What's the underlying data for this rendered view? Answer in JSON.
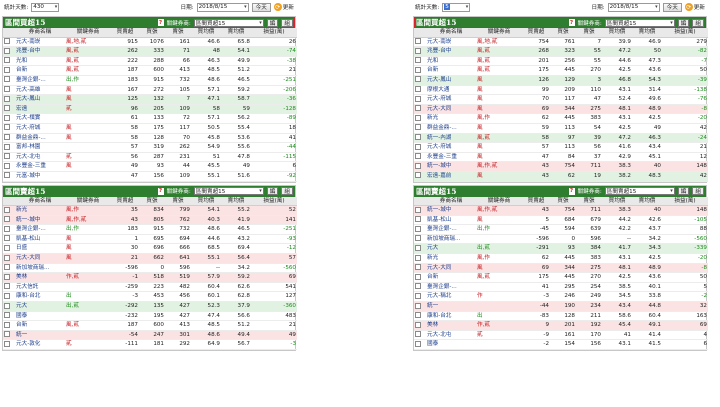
{
  "header_labels": {
    "days_label": "統計天數:",
    "date_label": "日期:",
    "today_button": "今天",
    "refresh_button": "更新",
    "key_broker_label": "關鍵券商:",
    "key_broker_select": "區間買超15",
    "key_broker_select_sell": "區間賣超15",
    "btn_edit": "編",
    "btn_group": "組",
    "help_icon_text": "?"
  },
  "screens": [
    {
      "days_value": "430",
      "date_value": "2018/8/15",
      "buy_title": "區間買超15",
      "sell_title": "區間賣超15",
      "buy_columns": [
        "",
        "券商名稱",
        "關鍵券商",
        "買賣超",
        "買張",
        "賣張",
        "買均價",
        "賣均價",
        "損益(萬)"
      ],
      "sell_columns": [
        "",
        "券商名稱",
        "關鍵券商",
        "買賣超",
        "買張",
        "賣張",
        "買均價",
        "賣均價",
        "損益(萬)"
      ],
      "buy_rows": [
        {
          "name": "元大-南崁",
          "tag": "風,地,貳",
          "net": "915",
          "buy": "1076",
          "sell": "161",
          "bavg": "46.6",
          "savg": "65.8",
          "pnl": "26",
          "row": ""
        },
        {
          "name": "兆豐-台中",
          "tag": "風,貳",
          "net": "262",
          "buy": "333",
          "sell": "71",
          "bavg": "48",
          "savg": "54.1",
          "pnl": "-74",
          "row": "green"
        },
        {
          "name": "光和",
          "tag": "風,貳",
          "net": "222",
          "buy": "288",
          "sell": "66",
          "bavg": "46.3",
          "savg": "49.9",
          "pnl": "-38",
          "row": ""
        },
        {
          "name": "台新",
          "tag": "風,貳",
          "net": "187",
          "buy": "600",
          "sell": "413",
          "bavg": "48.5",
          "savg": "51.2",
          "pnl": "21",
          "row": ""
        },
        {
          "name": "臺灣企銀-...",
          "tag": "出,作",
          "net": "183",
          "buy": "915",
          "sell": "732",
          "bavg": "48.6",
          "savg": "46.5",
          "pnl": "-251",
          "row": ""
        },
        {
          "name": "元大-高雄",
          "tag": "風",
          "net": "167",
          "buy": "272",
          "sell": "105",
          "bavg": "57.1",
          "savg": "59.2",
          "pnl": "-206",
          "row": ""
        },
        {
          "name": "元大-鳳山",
          "tag": "風",
          "net": "125",
          "buy": "132",
          "sell": "7",
          "bavg": "47.1",
          "savg": "58.7",
          "pnl": "-36",
          "row": "green"
        },
        {
          "name": "宏遠",
          "tag": "貳",
          "net": "96",
          "buy": "205",
          "sell": "109",
          "bavg": "58",
          "savg": "59",
          "pnl": "-128",
          "row": "green"
        },
        {
          "name": "元大-樸實",
          "tag": "",
          "net": "61",
          "buy": "133",
          "sell": "72",
          "bavg": "57.1",
          "savg": "56.2",
          "pnl": "-89",
          "row": ""
        },
        {
          "name": "元大-府城",
          "tag": "風",
          "net": "58",
          "buy": "175",
          "sell": "117",
          "bavg": "50.5",
          "savg": "55.4",
          "pnl": "18",
          "row": ""
        },
        {
          "name": "群益金鼎-...",
          "tag": "風",
          "net": "58",
          "buy": "128",
          "sell": "70",
          "bavg": "45.8",
          "savg": "53.6",
          "pnl": "41",
          "row": ""
        },
        {
          "name": "富邦-林園",
          "tag": "",
          "net": "57",
          "buy": "319",
          "sell": "262",
          "bavg": "54.9",
          "savg": "55.6",
          "pnl": "-44",
          "row": ""
        },
        {
          "name": "元大-北屯",
          "tag": "貳",
          "net": "56",
          "buy": "287",
          "sell": "231",
          "bavg": "51",
          "savg": "47.8",
          "pnl": "-115",
          "row": ""
        },
        {
          "name": "永豐金-三重",
          "tag": "風",
          "net": "49",
          "buy": "93",
          "sell": "44",
          "bavg": "45.5",
          "savg": "49",
          "pnl": "6",
          "row": ""
        },
        {
          "name": "元富-城中",
          "tag": "",
          "net": "47",
          "buy": "156",
          "sell": "109",
          "bavg": "55.1",
          "savg": "51.6",
          "pnl": "-92",
          "row": ""
        }
      ],
      "sell_rows": [
        {
          "name": "新光",
          "tag": "風,作",
          "net": "35",
          "buy": "834",
          "sell": "799",
          "bavg": "54.1",
          "savg": "55.2",
          "pnl": "52",
          "row": "pink"
        },
        {
          "name": "統一-城中",
          "tag": "風,作,貳",
          "net": "43",
          "buy": "805",
          "sell": "762",
          "bavg": "40.3",
          "savg": "41.9",
          "pnl": "141",
          "row": "pink"
        },
        {
          "name": "臺灣企銀-...",
          "tag": "出,作",
          "net": "183",
          "buy": "915",
          "sell": "732",
          "bavg": "48.6",
          "savg": "46.5",
          "pnl": "-251",
          "row": ""
        },
        {
          "name": "凱基-松山",
          "tag": "風",
          "net": "1",
          "buy": "695",
          "sell": "694",
          "bavg": "44.6",
          "savg": "43.2",
          "pnl": "-93",
          "row": ""
        },
        {
          "name": "日盛",
          "tag": "風",
          "net": "30",
          "buy": "696",
          "sell": "666",
          "bavg": "68.5",
          "savg": "69.4",
          "pnl": "-12",
          "row": ""
        },
        {
          "name": "元大-大同",
          "tag": "風",
          "net": "21",
          "buy": "662",
          "sell": "641",
          "bavg": "55.1",
          "savg": "56.4",
          "pnl": "57",
          "row": "pink"
        },
        {
          "name": "新加坡商瑞...",
          "tag": "",
          "net": "-596",
          "buy": "0",
          "sell": "596",
          "bavg": "--",
          "savg": "34.2",
          "pnl": "-560",
          "row": ""
        },
        {
          "name": "美林",
          "tag": "作,貳",
          "net": "-1",
          "buy": "518",
          "sell": "519",
          "bavg": "57.9",
          "savg": "59.2",
          "pnl": "69",
          "row": "pink"
        },
        {
          "name": "元大信託",
          "tag": "",
          "net": "-259",
          "buy": "223",
          "sell": "482",
          "bavg": "60.4",
          "savg": "62.6",
          "pnl": "541",
          "row": ""
        },
        {
          "name": "康和-台北",
          "tag": "出",
          "net": "-3",
          "buy": "453",
          "sell": "456",
          "bavg": "60.1",
          "savg": "62.8",
          "pnl": "127",
          "row": ""
        },
        {
          "name": "元大",
          "tag": "出,貳",
          "net": "-292",
          "buy": "135",
          "sell": "427",
          "bavg": "52.3",
          "savg": "37.9",
          "pnl": "-360",
          "row": "green"
        },
        {
          "name": "國泰",
          "tag": "",
          "net": "-232",
          "buy": "195",
          "sell": "427",
          "bavg": "47.4",
          "savg": "56.6",
          "pnl": "483",
          "row": ""
        },
        {
          "name": "台新",
          "tag": "風,貳",
          "net": "187",
          "buy": "600",
          "sell": "413",
          "bavg": "48.5",
          "savg": "51.2",
          "pnl": "21",
          "row": ""
        },
        {
          "name": "統一",
          "tag": "",
          "net": "-54",
          "buy": "247",
          "sell": "301",
          "bavg": "48.6",
          "savg": "49.4",
          "pnl": "49",
          "row": "pink"
        },
        {
          "name": "元大-敦化",
          "tag": "貳",
          "net": "-111",
          "buy": "181",
          "sell": "292",
          "bavg": "64.9",
          "savg": "56.7",
          "pnl": "-3",
          "row": ""
        }
      ]
    },
    {
      "days_value": "5",
      "date_value": "2018/8/15",
      "buy_title": "區間買超15",
      "sell_title": "區間賣超15",
      "buy_columns": [
        "",
        "券商名稱",
        "關鍵券商",
        "買賣超",
        "買張",
        "賣張",
        "買均價",
        "賣均價",
        "損益(萬)"
      ],
      "sell_columns": [
        "",
        "券商名稱",
        "關鍵券商",
        "買賣超",
        "買張",
        "賣張",
        "買均價",
        "賣均價",
        "損益(萬)"
      ],
      "buy_rows": [
        {
          "name": "元大-南崁",
          "tag": "風,地,貳",
          "net": "754",
          "buy": "761",
          "sell": "7",
          "bavg": "39.9",
          "savg": "46.9",
          "pnl": "279",
          "row": ""
        },
        {
          "name": "兆豐-台中",
          "tag": "風,貳",
          "net": "268",
          "buy": "323",
          "sell": "55",
          "bavg": "47.2",
          "savg": "50",
          "pnl": "-82",
          "row": "green"
        },
        {
          "name": "光和",
          "tag": "風,貳",
          "net": "201",
          "buy": "256",
          "sell": "55",
          "bavg": "44.6",
          "savg": "47.3",
          "pnl": "-7",
          "row": ""
        },
        {
          "name": "台新",
          "tag": "風,貳",
          "net": "175",
          "buy": "445",
          "sell": "270",
          "bavg": "42.5",
          "savg": "43.6",
          "pnl": "50",
          "row": ""
        },
        {
          "name": "元大-鳳山",
          "tag": "風",
          "net": "126",
          "buy": "129",
          "sell": "3",
          "bavg": "46.8",
          "savg": "54.3",
          "pnl": "-39",
          "row": "green"
        },
        {
          "name": "摩根大通",
          "tag": "風",
          "net": "99",
          "buy": "209",
          "sell": "110",
          "bavg": "43.1",
          "savg": "31.4",
          "pnl": "-138",
          "row": ""
        },
        {
          "name": "元大-府城",
          "tag": "風",
          "net": "70",
          "buy": "117",
          "sell": "47",
          "bavg": "52.4",
          "savg": "49.6",
          "pnl": "-76",
          "row": ""
        },
        {
          "name": "元大-大同",
          "tag": "風",
          "net": "69",
          "buy": "344",
          "sell": "275",
          "bavg": "48.1",
          "savg": "48.9",
          "pnl": "-8",
          "row": "pink"
        },
        {
          "name": "新光",
          "tag": "風,作",
          "net": "62",
          "buy": "445",
          "sell": "383",
          "bavg": "43.1",
          "savg": "42.5",
          "pnl": "-20",
          "row": ""
        },
        {
          "name": "群益金鼎-...",
          "tag": "風",
          "net": "59",
          "buy": "113",
          "sell": "54",
          "bavg": "42.5",
          "savg": "49",
          "pnl": "42",
          "row": ""
        },
        {
          "name": "統一-內湖",
          "tag": "風,貳",
          "net": "58",
          "buy": "97",
          "sell": "39",
          "bavg": "47.2",
          "savg": "46.3",
          "pnl": "-24",
          "row": "green"
        },
        {
          "name": "元大-府城",
          "tag": "風",
          "net": "57",
          "buy": "113",
          "sell": "56",
          "bavg": "41.6",
          "savg": "43.4",
          "pnl": "21",
          "row": ""
        },
        {
          "name": "永豐金-三重",
          "tag": "風",
          "net": "47",
          "buy": "84",
          "sell": "37",
          "bavg": "42.9",
          "savg": "45.1",
          "pnl": "12",
          "row": ""
        },
        {
          "name": "統一-城中",
          "tag": "風,作,貳",
          "net": "43",
          "buy": "754",
          "sell": "711",
          "bavg": "38.3",
          "savg": "40",
          "pnl": "148",
          "row": "pink"
        },
        {
          "name": "宏遠-嘉前",
          "tag": "風",
          "net": "43",
          "buy": "62",
          "sell": "19",
          "bavg": "38.2",
          "savg": "48.3",
          "pnl": "42",
          "row": "green"
        }
      ],
      "sell_rows": [
        {
          "name": "統一-城中",
          "tag": "風,作,貳",
          "net": "43",
          "buy": "754",
          "sell": "711",
          "bavg": "38.3",
          "savg": "40",
          "pnl": "148",
          "row": "pink"
        },
        {
          "name": "凱基-松山",
          "tag": "風",
          "net": "5",
          "buy": "684",
          "sell": "679",
          "bavg": "44.2",
          "savg": "42.6",
          "pnl": "-105",
          "row": ""
        },
        {
          "name": "臺灣企銀-...",
          "tag": "出,作",
          "net": "-45",
          "buy": "594",
          "sell": "639",
          "bavg": "42.2",
          "savg": "43.7",
          "pnl": "88",
          "row": ""
        },
        {
          "name": "新加坡商瑞...",
          "tag": "",
          "net": "-596",
          "buy": "0",
          "sell": "596",
          "bavg": "--",
          "savg": "34.2",
          "pnl": "-560",
          "row": ""
        },
        {
          "name": "元大",
          "tag": "出,貳",
          "net": "-291",
          "buy": "93",
          "sell": "384",
          "bavg": "41.7",
          "savg": "34.3",
          "pnl": "-339",
          "row": "green"
        },
        {
          "name": "新光",
          "tag": "風,作",
          "net": "62",
          "buy": "445",
          "sell": "383",
          "bavg": "43.1",
          "savg": "42.5",
          "pnl": "-20",
          "row": ""
        },
        {
          "name": "元大-大同",
          "tag": "風",
          "net": "69",
          "buy": "344",
          "sell": "275",
          "bavg": "48.1",
          "savg": "48.9",
          "pnl": "-8",
          "row": "pink"
        },
        {
          "name": "台新",
          "tag": "風,貳",
          "net": "175",
          "buy": "445",
          "sell": "270",
          "bavg": "42.5",
          "savg": "43.6",
          "pnl": "50",
          "row": ""
        },
        {
          "name": "臺灣企銀-...",
          "tag": "",
          "net": "41",
          "buy": "295",
          "sell": "254",
          "bavg": "38.5",
          "savg": "40.1",
          "pnl": "5",
          "row": ""
        },
        {
          "name": "元大-稱北",
          "tag": "作",
          "net": "-3",
          "buy": "246",
          "sell": "249",
          "bavg": "34.5",
          "savg": "33.8",
          "pnl": "-2",
          "row": ""
        },
        {
          "name": "統一",
          "tag": "",
          "net": "-44",
          "buy": "190",
          "sell": "234",
          "bavg": "43.4",
          "savg": "44.8",
          "pnl": "32",
          "row": "pink"
        },
        {
          "name": "康和-台北",
          "tag": "出",
          "net": "-83",
          "buy": "128",
          "sell": "211",
          "bavg": "58.6",
          "savg": "60.4",
          "pnl": "163",
          "row": ""
        },
        {
          "name": "美林",
          "tag": "作,貳",
          "net": "9",
          "buy": "201",
          "sell": "192",
          "bavg": "45.4",
          "savg": "49.1",
          "pnl": "69",
          "row": "pink"
        },
        {
          "name": "元大-北屯",
          "tag": "貳",
          "net": "-9",
          "buy": "161",
          "sell": "170",
          "bavg": "41",
          "savg": "41.4",
          "pnl": "4",
          "row": ""
        },
        {
          "name": "國泰",
          "tag": "",
          "net": "-2",
          "buy": "154",
          "sell": "156",
          "bavg": "43.1",
          "savg": "41.5",
          "pnl": "6",
          "row": ""
        }
      ]
    }
  ]
}
